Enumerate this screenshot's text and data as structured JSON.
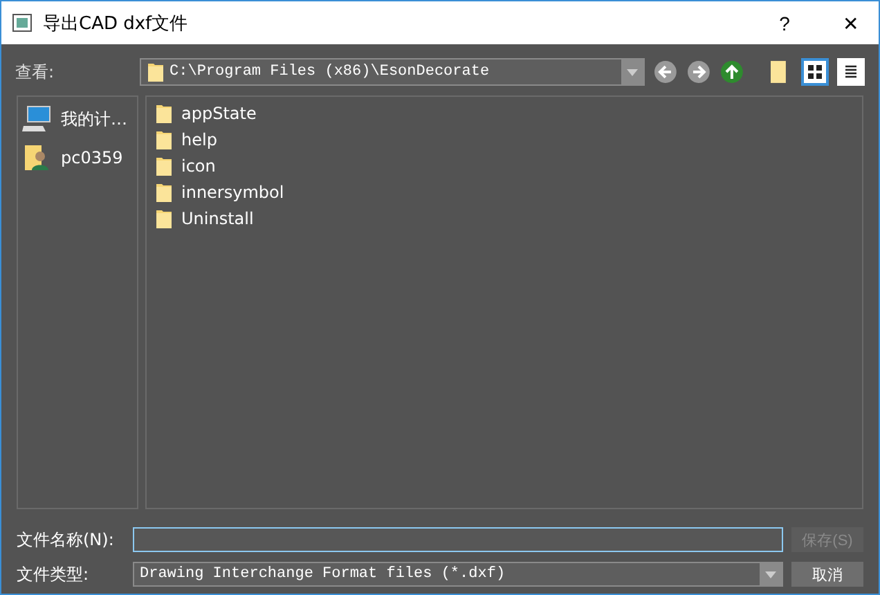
{
  "window": {
    "title": "导出CAD dxf文件",
    "help": "?",
    "close": "✕"
  },
  "toolbar": {
    "look_in_label": "查看:",
    "path": "C:\\Program Files (x86)\\EsonDecorate",
    "views": [
      {
        "kind": "icons",
        "selected": true
      },
      {
        "kind": "list",
        "selected": false
      }
    ]
  },
  "sidebar": {
    "items": [
      {
        "kind": "computer",
        "label": "我的计…",
        "selected": false
      },
      {
        "kind": "user",
        "label": "pc0359",
        "selected": false
      }
    ]
  },
  "files": [
    {
      "name": "appState",
      "selected": false
    },
    {
      "name": "help",
      "selected": false
    },
    {
      "name": "icon",
      "selected": false
    },
    {
      "name": "innersymbol",
      "selected": false
    },
    {
      "name": "Uninstall",
      "selected": false
    }
  ],
  "filename": {
    "label": "文件名称(N):"
  },
  "filetype": {
    "label": "文件类型:",
    "value": "Drawing Interchange Format files (*.dxf)"
  },
  "buttons": [
    {
      "kind": "save",
      "label": "保存(S)",
      "disabled": true
    },
    {
      "kind": "cancel",
      "label": "取消",
      "disabled": false
    }
  ]
}
